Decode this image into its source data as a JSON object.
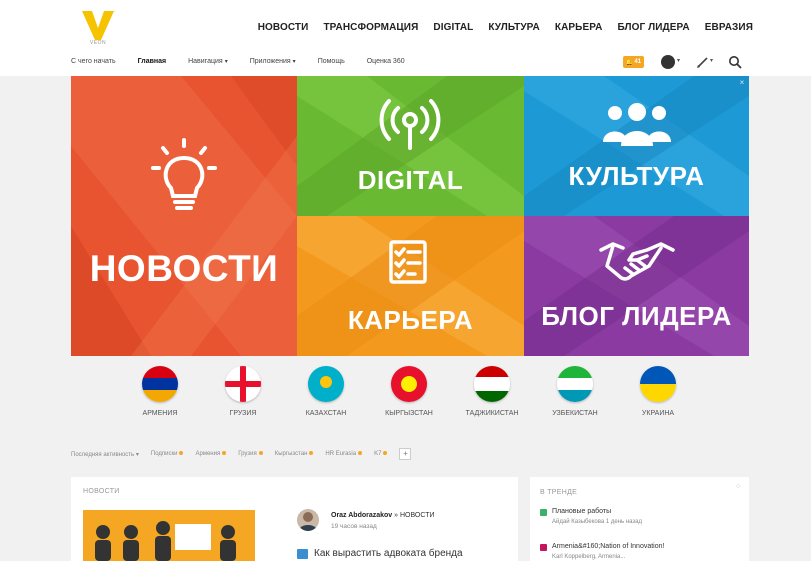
{
  "logo": {
    "letter": "V",
    "subtitle": "VEON"
  },
  "top_nav": [
    "НОВОСТИ",
    "ТРАНСФОРМАЦИЯ",
    "DIGITAL",
    "КУЛЬТУРА",
    "КАРЬЕРА",
    "БЛОГ ЛИДЕРА",
    "ЕВРАЗИЯ"
  ],
  "sub_nav": {
    "start": "С чего начать",
    "home": "Главная",
    "navigation": "Навигация",
    "apps": "Приложения",
    "help": "Помощь",
    "rating": "Оценка 360"
  },
  "toolbar": {
    "notifications_count": "41",
    "notifications_icon": "bell-icon",
    "avatar_icon": "user-avatar",
    "edit_icon": "pencil-icon",
    "search_icon": "search-icon"
  },
  "tiles": {
    "news": {
      "label": "НОВОСТИ",
      "icon": "lightbulb-icon",
      "color": "#e8542f"
    },
    "digital": {
      "label": "DIGITAL",
      "icon": "wireless-icon",
      "color": "#6ab932"
    },
    "culture": {
      "label": "КУЛЬТУРА",
      "icon": "people-icon",
      "color": "#1d9ad6"
    },
    "career": {
      "label": "КАРЬЕРА",
      "icon": "checklist-icon",
      "color": "#f39a1e"
    },
    "blog": {
      "label": "БЛОГ ЛИДЕРА",
      "icon": "handshake-icon",
      "color": "#8a3aa0"
    }
  },
  "countries": [
    {
      "name": "АРМЕНИЯ"
    },
    {
      "name": "ГРУЗИЯ"
    },
    {
      "name": "КАЗАХСТАН"
    },
    {
      "name": "КЫРГЫЗСТАН"
    },
    {
      "name": "ТАДЖИКИСТАН"
    },
    {
      "name": "УЗБЕКИСТАН"
    },
    {
      "name": "УКРАИНА"
    }
  ],
  "filters": {
    "recent": "Последняя активность",
    "items": [
      "Подписки",
      "Армения",
      "Грузия",
      "Кыргызстан",
      "HR Eurasia",
      "K7"
    ]
  },
  "news_card": {
    "title": "НОВОСТИ",
    "author": "Oraz Abdorazakov",
    "channel": "» НОВОСТИ",
    "time": "19 часов назад",
    "post_title": "Как вырастить адвоката бренда"
  },
  "trend_card": {
    "title": "В ТРЕНДЕ",
    "items": [
      {
        "title": "Плановые работы",
        "sub": "Айдай Казыбекова 1 день назад",
        "color": "#3ab06a"
      },
      {
        "title": "Armenia&#160;Nation of Innovation!",
        "sub": "Karl Koppelberg, Armenia...",
        "color": "#c2185b"
      }
    ]
  },
  "colors": {
    "accent": "#f5c300",
    "notif": "#f5a623"
  }
}
